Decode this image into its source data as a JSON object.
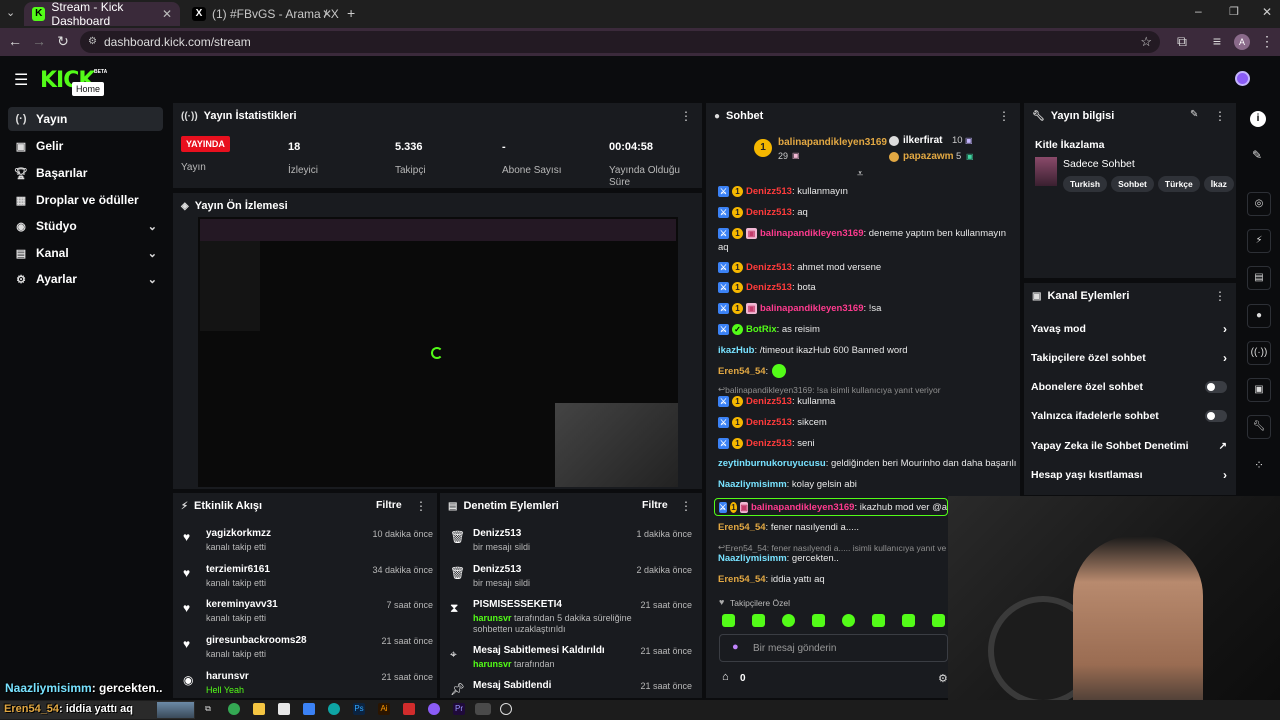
{
  "browser": {
    "tabs": [
      {
        "title": "Stream - Kick Dashboard"
      },
      {
        "title": "(1) #FBvGS - Arama / X"
      }
    ],
    "url": "dashboard.kick.com/stream",
    "profile_initial": "A"
  },
  "header": {
    "logo": "KICK",
    "beta": "BETA",
    "tooltip": "Home"
  },
  "sidebar": {
    "items": [
      {
        "label": "Yayın",
        "icon": "broadcast-icon"
      },
      {
        "label": "Gelir",
        "icon": "money-icon"
      },
      {
        "label": "Başarılar",
        "icon": "trophy-icon"
      },
      {
        "label": "Droplar ve ödüller",
        "icon": "gift-icon"
      },
      {
        "label": "Stüdyo",
        "icon": "studio-icon"
      },
      {
        "label": "Kanal",
        "icon": "channel-icon"
      },
      {
        "label": "Ayarlar",
        "icon": "gear-icon"
      }
    ]
  },
  "stats": {
    "title": "Yayın İstatistikleri",
    "live_badge": "YAYINDA",
    "live_label": "Yayın",
    "viewers_value": "18",
    "viewers_label": "İzleyici",
    "followers_value": "5.336",
    "followers_label": "Takipçi",
    "subs_value": "-",
    "subs_label": "Abone Sayısı",
    "duration_value": "00:04:58",
    "duration_label": "Yayında Olduğu Süre"
  },
  "preview": {
    "title": "Yayın Ön İzlemesi"
  },
  "activity": {
    "title": "Etkinlik Akışı",
    "filter": "Filtre",
    "items": [
      {
        "name": "yagizkorkmzz",
        "sub": "kanalı takip etti",
        "time": "10 dakika önce"
      },
      {
        "name": "terziemir6161",
        "sub": "kanalı takip etti",
        "time": "34 dakika önce"
      },
      {
        "name": "kereminyavv31",
        "sub": "kanalı takip etti",
        "time": "7 saat önce"
      },
      {
        "name": "giresunbackrooms28",
        "sub": "kanalı takip etti",
        "time": "21 saat önce"
      },
      {
        "name": "harunsvr",
        "sub": "Hell Yeah",
        "time": "21 saat önce"
      }
    ]
  },
  "moderation": {
    "title": "Denetim Eylemleri",
    "filter": "Filtre",
    "items": [
      {
        "name": "Denizz513",
        "sub": "bir mesajı sildi",
        "time": "1 dakika önce"
      },
      {
        "name": "Denizz513",
        "sub": "bir mesajı sildi",
        "time": "2 dakika önce"
      },
      {
        "name": "PISMISESSEKETI4",
        "sub_user": "harunsvr",
        "sub": "tarafından 5 dakika süreliğine sohbetten uzaklaştırıldı",
        "time": "21 saat önce"
      },
      {
        "name": "Mesaj Sabitlemesi Kaldırıldı",
        "sub_user": "harunsvr",
        "sub": "tarafından",
        "time": "21 saat önce"
      },
      {
        "name": "Mesaj Sabitlendi",
        "sub": "",
        "time": "21 saat önce"
      }
    ]
  },
  "chat": {
    "title": "Sohbet",
    "top_gifter": {
      "name": "balinapandikleyen3169",
      "count": "29"
    },
    "gifter2": {
      "name": "ilkerfirat",
      "count": "10"
    },
    "gifter3": {
      "name": "papazawm",
      "count": "5"
    },
    "messages": [
      {
        "user": "Denizz513",
        "text": ": kullanmayın"
      },
      {
        "user": "Denizz513",
        "text": ": aq"
      },
      {
        "user": "balinapandikleyen3169",
        "text": ": deneme yaptım ben kullanmayın",
        "text2": "aq"
      },
      {
        "user": "Denizz513",
        "text": ": ahmet mod versene"
      },
      {
        "user": "Denizz513",
        "text": ": bota"
      },
      {
        "user": "balinapandikleyen3169",
        "text": ": !sa"
      },
      {
        "user": "BotRix",
        "text": ": as reisim"
      },
      {
        "user": "ikazHub",
        "text": ": /timeout ikazHub 600 Banned word"
      },
      {
        "user": "Eren54_54",
        "text": ":"
      },
      {
        "reply": "balinapandikleyen3169: !sa isimli kullanıcıya yanıt veriyor"
      },
      {
        "user": "Denizz513",
        "text": ": kullanma"
      },
      {
        "user": "Denizz513",
        "text": ": sikcem"
      },
      {
        "user": "Denizz513",
        "text": ": seni"
      },
      {
        "user": "zeytinburnukoruyucusu",
        "text": ": geldiğinden beri Mourinho dan daha başarılı"
      },
      {
        "user": "Naazliymisimm",
        "text": ": kolay gelsin abi"
      },
      {
        "user": "balinapandikleyen3169",
        "text": ": ikazhub mod ver @a"
      },
      {
        "user": "Eren54_54",
        "text": ": fener nasılyendi a....."
      },
      {
        "reply": "Eren54_54: fener nasılyendi a..... isimli kullanıcıya yanıt ve"
      },
      {
        "user": "Naazliymisimm",
        "text": ": gercekten.."
      },
      {
        "user": "Eren54_54",
        "text": ": iddia yattı aq"
      }
    ],
    "followers_only": "Takipçilere Özel",
    "input_placeholder": "Bir mesaj gönderin",
    "points": "0"
  },
  "stream_info": {
    "title": "Yayın bilgisi",
    "audience_warning": "Kitle İkazlama",
    "stream_title": "Sadece Sohbet",
    "tags": [
      "Turkish",
      "Sohbet",
      "Türkçe",
      "İkaz"
    ]
  },
  "channel_actions": {
    "title": "Kanal Eylemleri",
    "items": [
      {
        "label": "Yavaş mod",
        "type": "arrow"
      },
      {
        "label": "Takipçilere özel sohbet",
        "type": "arrow"
      },
      {
        "label": "Abonelere özel sohbet",
        "type": "toggle"
      },
      {
        "label": "Yalnızca ifadelerle sohbet",
        "type": "toggle"
      },
      {
        "label": "Yapay Zeka ile Sohbet Denetimi",
        "type": "external"
      },
      {
        "label": "Hesap yaşı kısıtlaması",
        "type": "arrow"
      }
    ]
  },
  "overlay": {
    "line1_user": "Naazliymisimm",
    "line1_text": ": gercekten..",
    "line2_user": "Eren54_54",
    "line2_text": ": iddia yattı aq"
  },
  "colors": {
    "brand": "#53fc18",
    "live": "#e8101e",
    "panel": "#191b1f",
    "background": "#0b0c0e"
  }
}
